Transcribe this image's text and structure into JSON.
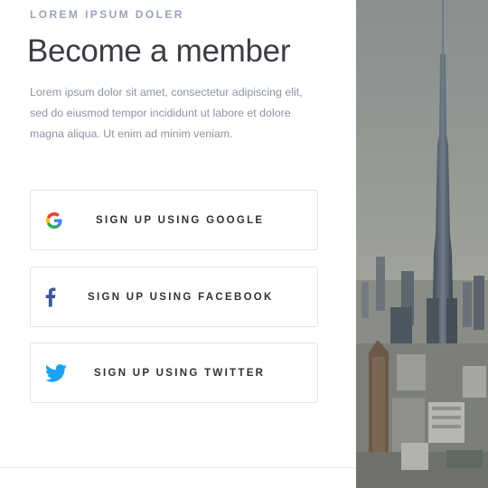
{
  "eyebrow": "LOREM IPSUM DOLER",
  "title": "Become a member",
  "description": "Lorem ipsum dolor sit amet, consectetur adipiscing elit, sed do eiusmod tempor incididunt ut labore et dolore magna aliqua. Ut enim ad minim veniam.",
  "buttons": {
    "google": {
      "label": "SIGN UP USING GOOGLE",
      "icon": "google-icon"
    },
    "facebook": {
      "label": "SIGN UP USING FACEBOOK",
      "icon": "facebook-icon",
      "color": "#3b5998"
    },
    "twitter": {
      "label": "SIGN UP USING TWITTER",
      "icon": "twitter-icon",
      "color": "#1da1f2"
    }
  },
  "colors": {
    "eyebrow": "#9aa3b6",
    "title": "#3b3d45",
    "text": "#8d93a3",
    "button_border": "#e2e4ea"
  },
  "hero_image": {
    "subject": "city-skyline-photo"
  }
}
